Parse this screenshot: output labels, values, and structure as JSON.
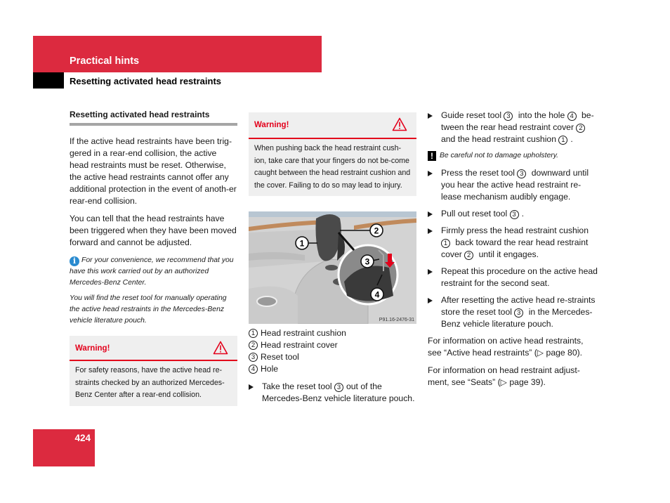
{
  "header": {
    "section": "Practical hints",
    "subsection": "Resetting activated head restraints"
  },
  "column1": {
    "heading": "Resetting activated head restraints",
    "paragraphs": [
      "If the active head restraints have been trig-gered in a rear-end collision, the active head restraints must be reset. Otherwise, the active head restraints cannot offer any additional protection in the event of anoth-er rear-end collision.",
      "You can tell that the head restraints have been triggered when they have been moved forward and cannot be adjusted."
    ],
    "notes": [
      "For your convenience, we recommend that you have this work carried out by an authorized Mercedes-Benz Center.",
      "You will find the reset tool for manually operating the active head restraints in the Mercedes-Benz vehicle literature pouch."
    ],
    "info_icon": "i",
    "warning": {
      "title": "Warning!",
      "icon": "warning-triangle-icon",
      "body": "For safety reasons, have the active head re-straints checked by an authorized Mercedes-Benz Center after a rear-end collision."
    }
  },
  "column2": {
    "warning": {
      "title": "Warning!",
      "icon": "warning-triangle-icon",
      "body": "When pushing back the head restraint cush-ion, take care that your fingers do not be-come caught between the head restraint cushion and the cover. Failing to do so may lead to injury."
    },
    "image": {
      "code": "P91.16-2476-31",
      "callouts": [
        "1",
        "2",
        "3",
        "4"
      ]
    },
    "legend": [
      {
        "num": "1",
        "label": "Head restraint cushion"
      },
      {
        "num": "2",
        "label": "Head restraint cover"
      },
      {
        "num": "3",
        "label": "Reset tool"
      },
      {
        "num": "4",
        "label": "Hole"
      }
    ],
    "step1": {
      "a": "Take the reset tool",
      "ref": "3",
      "b": "out of the Mercedes-Benz vehicle literature pouch."
    }
  },
  "column3": {
    "steps": [
      {
        "parts": [
          "Guide reset tool ",
          "3",
          " into the hole ",
          "4",
          " be-tween the rear head restraint cover ",
          "2",
          " and the head restraint cushion ",
          "1",
          "."
        ]
      },
      {
        "parts": [
          "Press the reset tool ",
          "3",
          " downward until you hear the active head restraint re-lease mechanism audibly engage."
        ]
      },
      {
        "parts": [
          "Pull out reset tool ",
          "3",
          "."
        ]
      },
      {
        "parts": [
          "Firmly press the head restraint cushion ",
          "1",
          " back toward the rear head restraint cover ",
          "2",
          " until it engages."
        ]
      },
      {
        "parts": [
          "Repeat this procedure on the active head restraint for the second seat."
        ]
      },
      {
        "parts": [
          "After resetting the active head re-straints store the reset tool ",
          "3",
          " in the Mercedes-Benz vehicle literature pouch."
        ]
      }
    ],
    "caution": "Be careful not to damage upholstery.",
    "caution_icon": "!",
    "refs": [
      "For information on active head restraints, see “Active head restraints” (▷ page 80).",
      "For information on head restraint adjust-ment, see “Seats” (▷ page 39)."
    ]
  },
  "footer": {
    "page_number": "424"
  },
  "colors": {
    "brand_red": "#dc2a3f",
    "warning_red": "#e3001b",
    "info_blue": "#2a8bd0"
  }
}
